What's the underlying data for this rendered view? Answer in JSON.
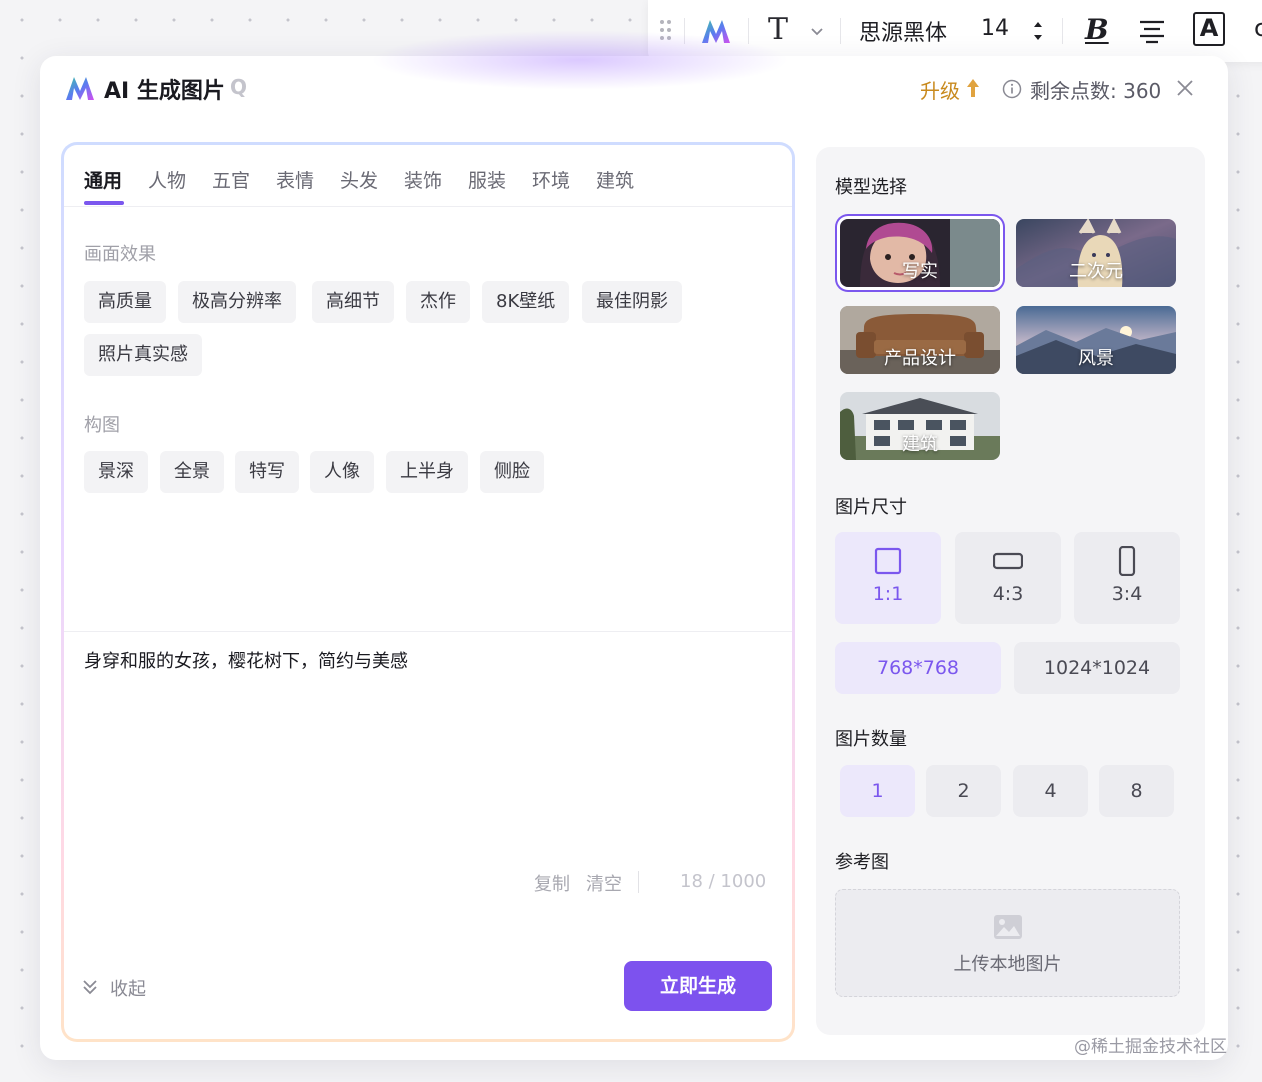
{
  "toolbar": {
    "font_family": "思源黑体",
    "font_size": "14",
    "bold": "B",
    "text_color": "A"
  },
  "dialog": {
    "title": "AI 生成图片",
    "help": "Q",
    "upgrade": "升级",
    "points": "剩余点数: 360"
  },
  "tabs": [
    {
      "label": "通用",
      "active": true
    },
    {
      "label": "人物"
    },
    {
      "label": "五官"
    },
    {
      "label": "表情"
    },
    {
      "label": "头发"
    },
    {
      "label": "装饰"
    },
    {
      "label": "服装"
    },
    {
      "label": "环境"
    },
    {
      "label": "建筑"
    }
  ],
  "effects": {
    "title": "画面效果",
    "chips": [
      "高质量",
      "极高分辨率",
      "高细节",
      "杰作",
      "8K壁纸",
      "最佳阴影",
      "照片真实感"
    ]
  },
  "composition": {
    "title": "构图",
    "chips": [
      "景深",
      "全景",
      "特写",
      "人像",
      "上半身",
      "侧脸"
    ]
  },
  "prompt": {
    "text": "身穿和服的女孩，樱花树下，简约与美感",
    "copy": "复制",
    "clear": "清空",
    "count": "18 / 1000"
  },
  "collapse": "收起",
  "generate": "立即生成",
  "settings": {
    "model_label": "模型选择",
    "models": [
      {
        "name": "写实",
        "selected": true
      },
      {
        "name": "二次元"
      },
      {
        "name": "产品设计"
      },
      {
        "name": "风景"
      },
      {
        "name": "建筑"
      }
    ],
    "size_label": "图片尺寸",
    "ratios": [
      {
        "label": "1:1",
        "selected": true
      },
      {
        "label": "4:3"
      },
      {
        "label": "3:4"
      }
    ],
    "resolutions": [
      {
        "label": "768*768",
        "selected": true
      },
      {
        "label": "1024*1024"
      }
    ],
    "count_label": "图片数量",
    "counts": [
      {
        "label": "1",
        "selected": true
      },
      {
        "label": "2"
      },
      {
        "label": "4"
      },
      {
        "label": "8"
      }
    ],
    "ref_label": "参考图",
    "upload": "上传本地图片"
  },
  "watermark": "@稀土掘金技术社区",
  "colors": {
    "accent": "#7b57ee",
    "upgrade": "#c88a1e"
  }
}
